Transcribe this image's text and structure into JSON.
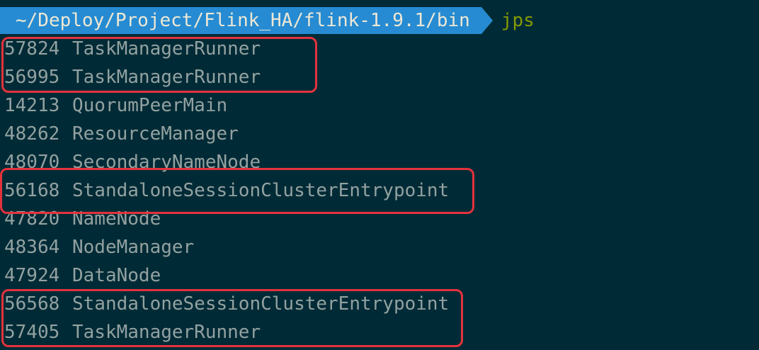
{
  "terminal": {
    "prompt_path": "~/Deploy/Project/Flink_HA/flink-1.9.1/bin",
    "command": "jps",
    "processes": [
      {
        "pid": "57824",
        "name": "TaskManagerRunner"
      },
      {
        "pid": "56995",
        "name": "TaskManagerRunner"
      },
      {
        "pid": "14213",
        "name": "QuorumPeerMain"
      },
      {
        "pid": "48262",
        "name": "ResourceManager"
      },
      {
        "pid": "48070",
        "name": "SecondaryNameNode"
      },
      {
        "pid": "56168",
        "name": "StandaloneSessionClusterEntrypoint"
      },
      {
        "pid": "47820",
        "name": "NameNode"
      },
      {
        "pid": "48364",
        "name": "NodeManager"
      },
      {
        "pid": "47924",
        "name": "DataNode"
      },
      {
        "pid": "56568",
        "name": "StandaloneSessionClusterEntrypoint"
      },
      {
        "pid": "57405",
        "name": "TaskManagerRunner"
      }
    ]
  },
  "colors": {
    "background": "#002b36",
    "prompt_segment": "#268bd2",
    "command": "#859900",
    "text": "#93a1a1",
    "highlight": "#e4323c"
  }
}
